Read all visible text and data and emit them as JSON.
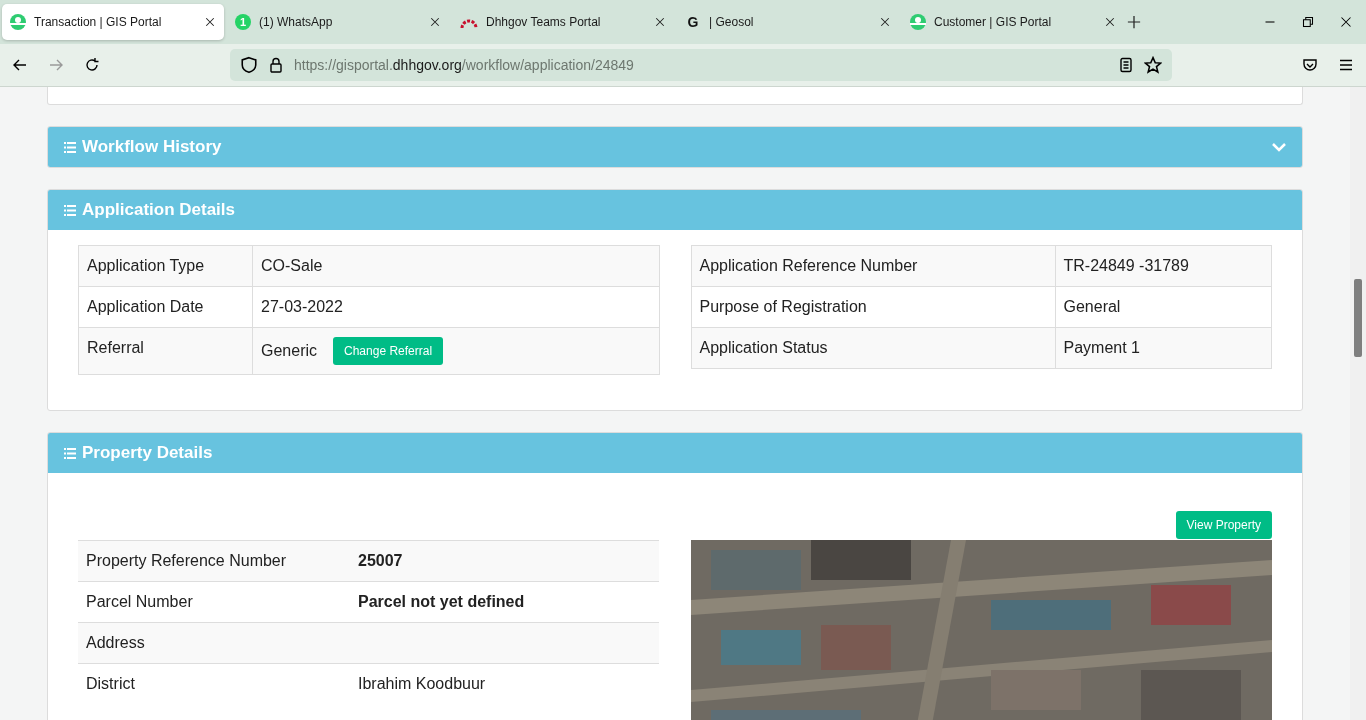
{
  "browser": {
    "tabs": [
      {
        "title": "Transaction | GIS Portal",
        "selected": true
      },
      {
        "title": "(1) WhatsApp",
        "badge": "1",
        "selected": false
      },
      {
        "title": "Dhhgov Teams Portal",
        "selected": false
      },
      {
        "title": "| Geosol",
        "badge": "G",
        "selected": false
      },
      {
        "title": "Customer | GIS Portal",
        "selected": false
      }
    ],
    "url": {
      "prefix": "https://gisportal.",
      "domain": "dhhgov.org",
      "path": "/workflow/application/24849"
    }
  },
  "sections": [
    {
      "title": "Workflow History",
      "expanded": false
    },
    {
      "title": "Application Details",
      "expanded": true,
      "left_rows": [
        {
          "label": "Application Type",
          "value": "CO-Sale"
        },
        {
          "label": "Application Date",
          "value": "27-03-2022"
        },
        {
          "label": "Referral",
          "value": "Generic",
          "button": "Change Referral"
        }
      ],
      "right_rows": [
        {
          "label": "Application Reference Number",
          "value": "TR-24849 -31789"
        },
        {
          "label": "Purpose of Registration",
          "value": "General"
        },
        {
          "label": "Application Status",
          "value": "Payment 1"
        }
      ]
    },
    {
      "title": "Property Details",
      "expanded": true,
      "button": "View Property",
      "rows": [
        {
          "label": "Property Reference Number",
          "value": "25007",
          "bold": true
        },
        {
          "label": "Parcel Number",
          "value": "Parcel not yet defined",
          "bold": true
        },
        {
          "label": "Address"
        },
        {
          "label": "District",
          "value": "Ibrahim Koodbuur",
          "bold": false
        }
      ],
      "map": {
        "kind": "picture"
      }
    }
  ]
}
